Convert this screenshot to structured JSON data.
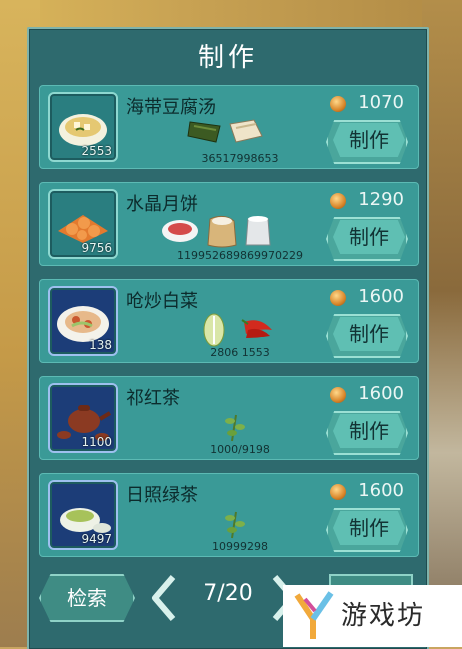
{
  "title": "制作",
  "recipes": [
    {
      "name": "海带豆腐汤",
      "price": "1070",
      "stock": "2553",
      "counts": "36517998653",
      "button": "制作"
    },
    {
      "name": "水晶月饼",
      "price": "1290",
      "stock": "9756",
      "counts": "119952689869970229",
      "button": "制作"
    },
    {
      "name": "呛炒白菜",
      "price": "1600",
      "stock": "138",
      "counts": "2806 1553",
      "button": "制作"
    },
    {
      "name": "祁红茶",
      "price": "1600",
      "stock": "1100",
      "counts": "1000/9198",
      "button": "制作"
    },
    {
      "name": "日照绿茶",
      "price": "1600",
      "stock": "9497",
      "counts": "10999298",
      "button": "制作"
    }
  ],
  "bottom": {
    "search": "检索",
    "page": "7/20"
  },
  "logo": {
    "text": "游戏坊"
  },
  "colors": {
    "panel": "#2e6a6e",
    "card": "#3a9a97",
    "accent": "#8ed8d0"
  }
}
